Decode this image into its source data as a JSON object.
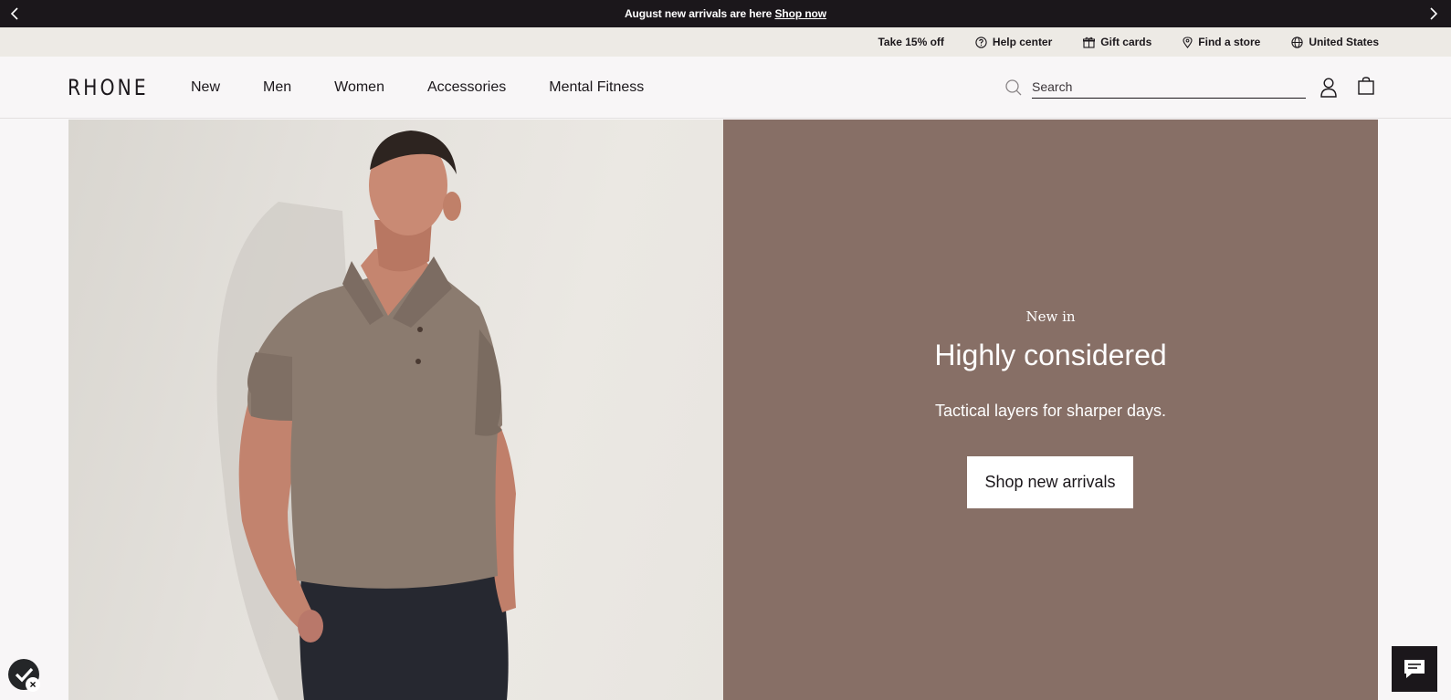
{
  "announcement": {
    "message": "August new arrivals are here",
    "link": "Shop now",
    "prev_icon": "chevron-left-icon",
    "next_icon": "chevron-right-icon"
  },
  "utility": {
    "promo": "Take 15% off",
    "help": "Help center",
    "gift": "Gift cards",
    "store": "Find a store",
    "region": "United States"
  },
  "header": {
    "logo": "RHONE",
    "nav": [
      "New",
      "Men",
      "Women",
      "Accessories",
      "Mental Fitness"
    ],
    "search_placeholder": "Search"
  },
  "hero": {
    "eyebrow": "New in",
    "title": "Highly considered",
    "subtitle": "Tactical layers for sharper days.",
    "cta": "Shop new arrivals",
    "panel_color": "#876f66"
  },
  "colors": {
    "announcement_bg": "#1b171b",
    "utility_bg": "#edeae5",
    "page_bg": "#f8f6f7"
  }
}
